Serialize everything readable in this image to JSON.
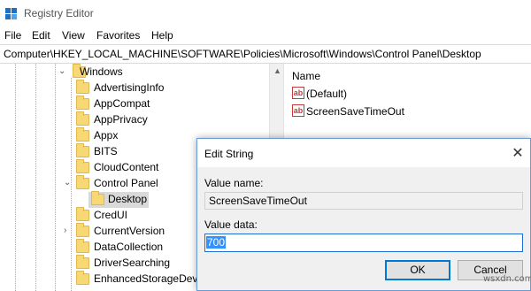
{
  "window": {
    "title": "Registry Editor",
    "icon": "registry-editor-icon"
  },
  "menu": [
    "File",
    "Edit",
    "View",
    "Favorites",
    "Help"
  ],
  "address": "Computer\\HKEY_LOCAL_MACHINE\\SOFTWARE\\Policies\\Microsoft\\Windows\\Control Panel\\Desktop",
  "tree": {
    "root": "Windows",
    "children": [
      "AdvertisingInfo",
      "AppCompat",
      "AppPrivacy",
      "Appx",
      "BITS",
      "CloudContent",
      "Control Panel"
    ],
    "control_panel_child": "Desktop",
    "after": [
      "CredUI",
      "CurrentVersion",
      "DataCollection",
      "DriverSearching",
      "EnhancedStorageDevi"
    ]
  },
  "values_pane": {
    "column_name": "Name",
    "rows": [
      "(Default)",
      "ScreenSaveTimeOut"
    ],
    "value_icon_text": "ab"
  },
  "dialog": {
    "title": "Edit String",
    "close": "✕",
    "value_name_label": "Value name:",
    "value_name": "ScreenSaveTimeOut",
    "value_data_label": "Value data:",
    "value_data": "700",
    "ok_label": "OK",
    "cancel_label": "Cancel"
  },
  "watermark": "wsxdn.com",
  "colors": {
    "accent": "#0078d7",
    "selection": "#3390ff",
    "folder": "#f8d775"
  }
}
